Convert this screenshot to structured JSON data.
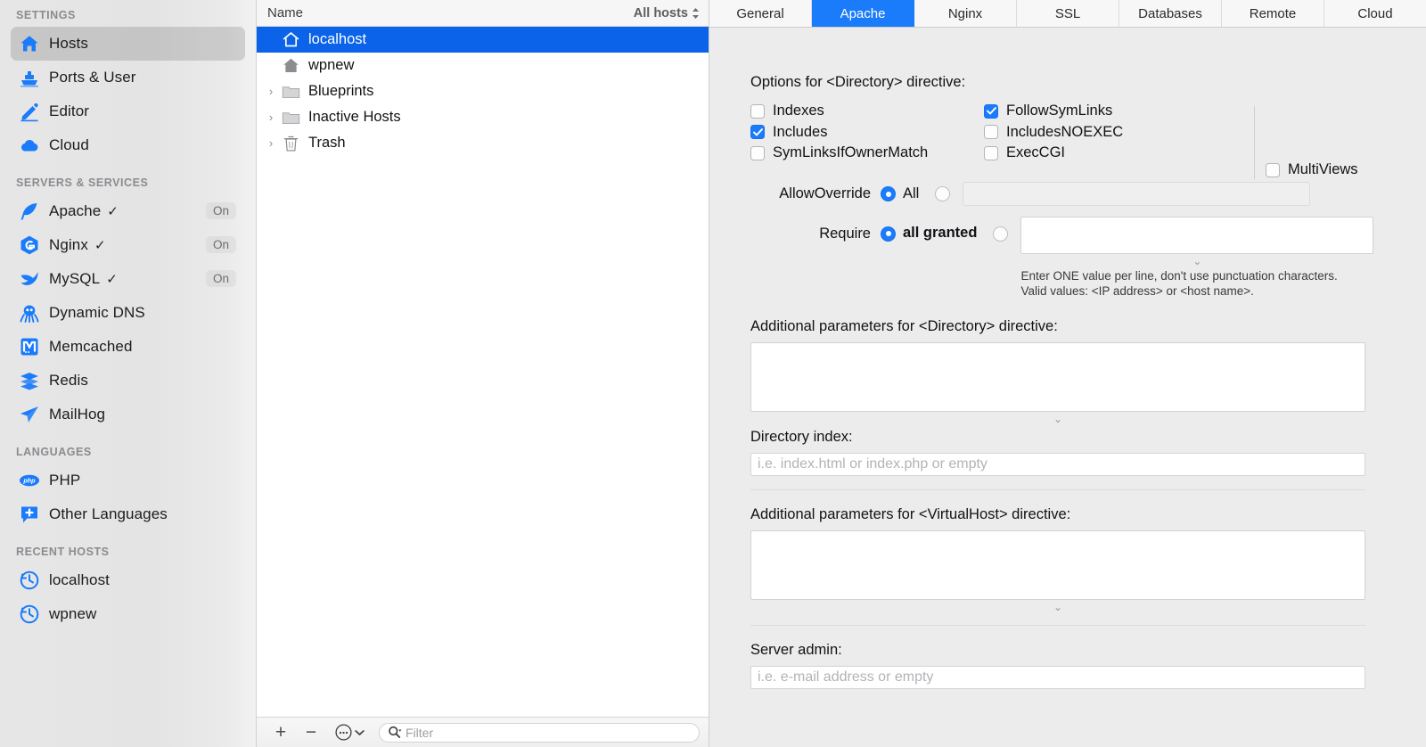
{
  "sidebar": {
    "sections": [
      {
        "heading": "SETTINGS",
        "items": [
          {
            "label": "Hosts",
            "icon": "house-icon",
            "selected": true,
            "status": ""
          },
          {
            "label": "Ports & User",
            "icon": "ship-icon",
            "selected": false,
            "status": ""
          },
          {
            "label": "Editor",
            "icon": "pencil-icon",
            "selected": false,
            "status": ""
          },
          {
            "label": "Cloud",
            "icon": "cloud-icon",
            "selected": false,
            "status": ""
          }
        ]
      },
      {
        "heading": "SERVERS & SERVICES",
        "items": [
          {
            "label": "Apache",
            "icon": "feather-icon",
            "selected": false,
            "check": "✓",
            "status": "On"
          },
          {
            "label": "Nginx",
            "icon": "nginx-g-icon",
            "selected": false,
            "check": "✓",
            "status": "On"
          },
          {
            "label": "MySQL",
            "icon": "dolphin-icon",
            "selected": false,
            "check": "✓",
            "status": "On"
          },
          {
            "label": "Dynamic DNS",
            "icon": "octopus-icon",
            "selected": false,
            "status": ""
          },
          {
            "label": "Memcached",
            "icon": "memcached-m-icon",
            "selected": false,
            "status": ""
          },
          {
            "label": "Redis",
            "icon": "redis-stack-icon",
            "selected": false,
            "status": ""
          },
          {
            "label": "MailHog",
            "icon": "paper-plane-icon",
            "selected": false,
            "status": ""
          }
        ]
      },
      {
        "heading": "LANGUAGES",
        "items": [
          {
            "label": "PHP",
            "icon": "php-icon",
            "selected": false,
            "status": ""
          },
          {
            "label": "Other Languages",
            "icon": "plus-badge-icon",
            "selected": false,
            "status": ""
          }
        ]
      },
      {
        "heading": "RECENT HOSTS",
        "items": [
          {
            "label": "localhost",
            "icon": "recent-clock-icon",
            "selected": false,
            "status": ""
          },
          {
            "label": "wpnew",
            "icon": "recent-clock-icon",
            "selected": false,
            "status": ""
          }
        ]
      }
    ]
  },
  "host_list": {
    "column_header": "Name",
    "sort_label": "All hosts",
    "rows": [
      {
        "label": "localhost",
        "icon": "house-outline-icon",
        "selected": true,
        "expandable": false
      },
      {
        "label": "wpnew",
        "icon": "house-filled-icon",
        "selected": false,
        "expandable": false
      },
      {
        "label": "Blueprints",
        "icon": "folder-icon",
        "selected": false,
        "expandable": true
      },
      {
        "label": "Inactive Hosts",
        "icon": "folder-icon",
        "selected": false,
        "expandable": true
      },
      {
        "label": "Trash",
        "icon": "trash-icon",
        "selected": false,
        "expandable": true
      }
    ],
    "toolbar": {
      "add": "+",
      "remove": "−",
      "more": "⋯",
      "filter_placeholder": "Filter"
    }
  },
  "tabs": [
    {
      "label": "General",
      "active": false
    },
    {
      "label": "Apache",
      "active": true
    },
    {
      "label": "Nginx",
      "active": false
    },
    {
      "label": "SSL",
      "active": false
    },
    {
      "label": "Databases",
      "active": false
    },
    {
      "label": "Remote",
      "active": false
    },
    {
      "label": "Cloud",
      "active": false
    }
  ],
  "apache": {
    "options_title": "Options for <Directory> directive:",
    "options_col1": [
      {
        "label": "Indexes",
        "checked": false
      },
      {
        "label": "Includes",
        "checked": true
      },
      {
        "label": "SymLinksIfOwnerMatch",
        "checked": false
      }
    ],
    "options_col2": [
      {
        "label": "FollowSymLinks",
        "checked": true
      },
      {
        "label": "IncludesNOEXEC",
        "checked": false
      },
      {
        "label": "ExecCGI",
        "checked": false
      }
    ],
    "options_col3": [
      {
        "label": "MultiViews",
        "checked": false
      }
    ],
    "allow_override": {
      "label": "AllowOverride",
      "option_label": "All",
      "selected": "all",
      "custom_value": ""
    },
    "require": {
      "label": "Require",
      "option_label": "all granted",
      "selected": "all granted",
      "custom_value": "",
      "hint_line1": "Enter ONE value per line, don't use punctuation characters.",
      "hint_line2": "Valid values: <IP address> or <host name>."
    },
    "additional_directory": {
      "label": "Additional parameters for <Directory> directive:",
      "value": ""
    },
    "directory_index": {
      "label": "Directory index:",
      "value": "",
      "placeholder": "i.e. index.html or index.php or empty"
    },
    "additional_virtualhost": {
      "label": "Additional parameters for <VirtualHost> directive:",
      "value": ""
    },
    "server_admin": {
      "label": "Server admin:",
      "value": "",
      "placeholder": "i.e. e-mail address or empty"
    },
    "resize_chevron": "⌄"
  },
  "colors": {
    "accent_blue": "#1a7bfb",
    "selection_blue": "#0a63e8",
    "sidebar_bg": "#e6e6e6",
    "content_bg": "#ececec"
  }
}
